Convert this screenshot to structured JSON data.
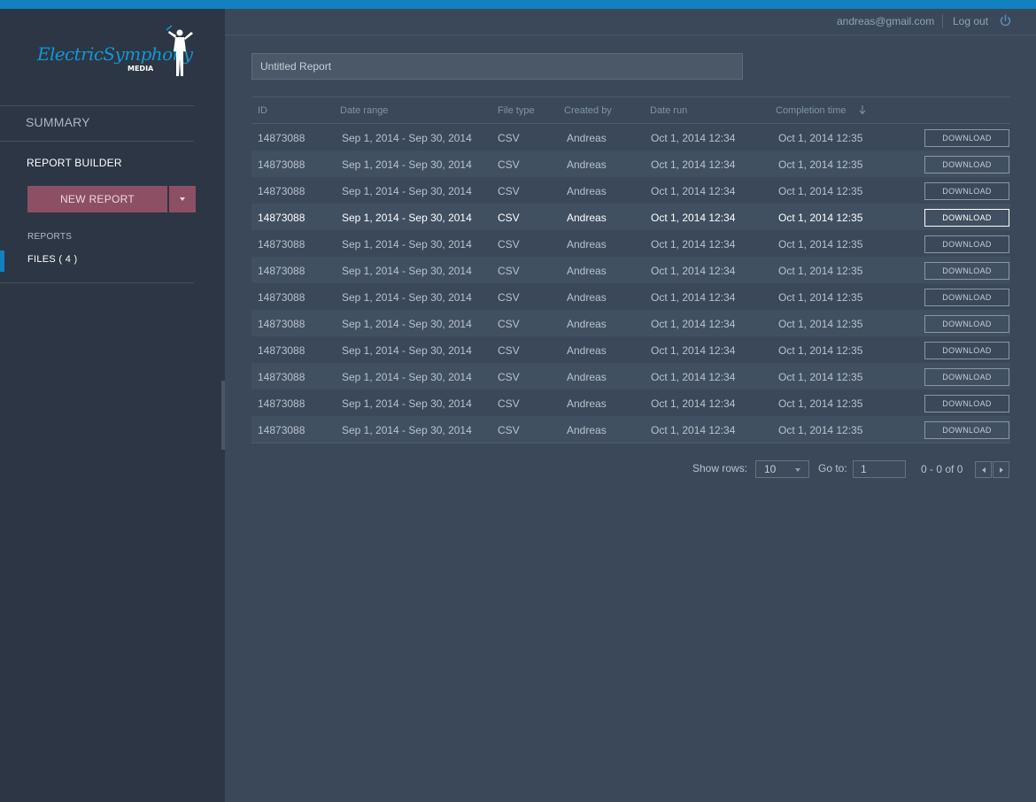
{
  "brand": {
    "name": "ElectricSymphony",
    "sub": "MEDIA"
  },
  "header": {
    "user_email": "andreas@gmail.com",
    "logout_label": "Log out",
    "logout_icon": "power-icon"
  },
  "sidebar": {
    "summary_label": "SUMMARY",
    "section_title": "REPORT BUILDER",
    "new_report_label": "NEW REPORT",
    "reports_label": "REPORTS",
    "files_label": "FILES ( 4 )"
  },
  "report": {
    "title": "Untitled Report"
  },
  "table": {
    "columns": [
      "ID",
      "Date range",
      "File type",
      "Created by",
      "Date run",
      "Completion time"
    ],
    "sort_icon": "arrow-down-icon",
    "download_label": "DOWNLOAD",
    "highlighted_row": 3,
    "rows": [
      [
        "14873088",
        "Sep 1, 2014 - Sep 30, 2014",
        "CSV",
        "Andreas",
        "Oct 1, 2014 12:34",
        "Oct 1, 2014 12:35"
      ],
      [
        "14873088",
        "Sep 1, 2014 - Sep 30, 2014",
        "CSV",
        "Andreas",
        "Oct 1, 2014 12:34",
        "Oct 1, 2014 12:35"
      ],
      [
        "14873088",
        "Sep 1, 2014 - Sep 30, 2014",
        "CSV",
        "Andreas",
        "Oct 1, 2014 12:34",
        "Oct 1, 2014 12:35"
      ],
      [
        "14873088",
        "Sep 1, 2014 - Sep 30, 2014",
        "CSV",
        "Andreas",
        "Oct 1, 2014 12:34",
        "Oct 1, 2014 12:35"
      ],
      [
        "14873088",
        "Sep 1, 2014 - Sep 30, 2014",
        "CSV",
        "Andreas",
        "Oct 1, 2014 12:34",
        "Oct 1, 2014 12:35"
      ],
      [
        "14873088",
        "Sep 1, 2014 - Sep 30, 2014",
        "CSV",
        "Andreas",
        "Oct 1, 2014 12:34",
        "Oct 1, 2014 12:35"
      ],
      [
        "14873088",
        "Sep 1, 2014 - Sep 30, 2014",
        "CSV",
        "Andreas",
        "Oct 1, 2014 12:34",
        "Oct 1, 2014 12:35"
      ],
      [
        "14873088",
        "Sep 1, 2014 - Sep 30, 2014",
        "CSV",
        "Andreas",
        "Oct 1, 2014 12:34",
        "Oct 1, 2014 12:35"
      ],
      [
        "14873088",
        "Sep 1, 2014 - Sep 30, 2014",
        "CSV",
        "Andreas",
        "Oct 1, 2014 12:34",
        "Oct 1, 2014 12:35"
      ],
      [
        "14873088",
        "Sep 1, 2014 - Sep 30, 2014",
        "CSV",
        "Andreas",
        "Oct 1, 2014 12:34",
        "Oct 1, 2014 12:35"
      ],
      [
        "14873088",
        "Sep 1, 2014 - Sep 30, 2014",
        "CSV",
        "Andreas",
        "Oct 1, 2014 12:34",
        "Oct 1, 2014 12:35"
      ],
      [
        "14873088",
        "Sep 1, 2014 - Sep 30, 2014",
        "CSV",
        "Andreas",
        "Oct 1, 2014 12:34",
        "Oct 1, 2014 12:35"
      ]
    ]
  },
  "pagination": {
    "show_rows_label": "Show rows:",
    "rows_value": "10",
    "goto_label": "Go to:",
    "goto_value": "1",
    "range_text": "0 - 0 of 0"
  },
  "colors": {
    "accent": "#1181c1",
    "button": "#8c4f63",
    "sidebar": "#2c3645",
    "main": "#3a4859"
  }
}
